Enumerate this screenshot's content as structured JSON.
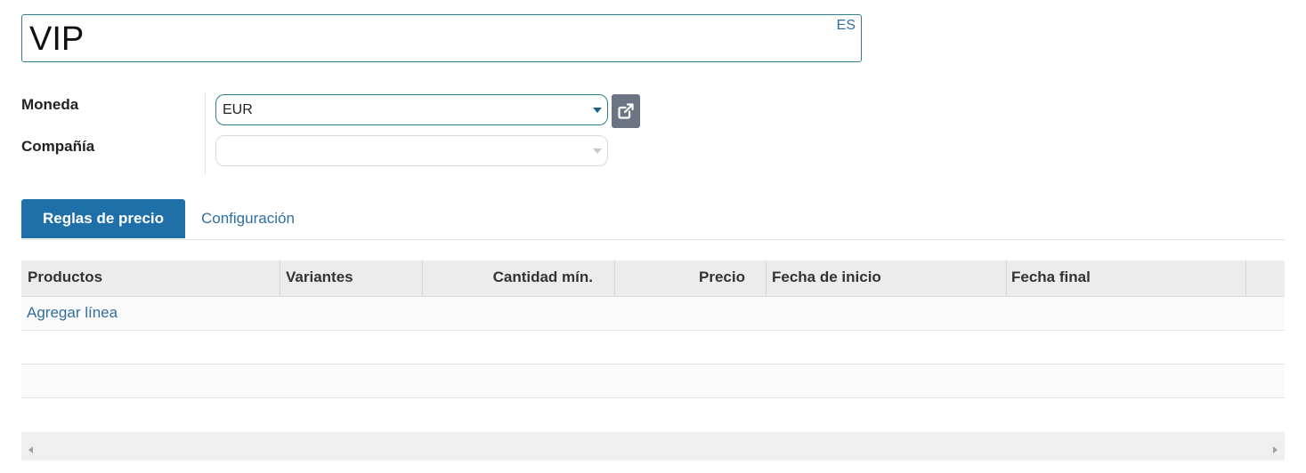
{
  "record": {
    "name": "VIP",
    "lang_button": "ES"
  },
  "form": {
    "currency_label": "Moneda",
    "currency_value": "EUR",
    "company_label": "Compañía",
    "company_value": ""
  },
  "tabs": [
    {
      "label": "Reglas de precio",
      "active": true
    },
    {
      "label": "Configuración",
      "active": false
    }
  ],
  "table": {
    "columns": [
      "Productos",
      "Variantes",
      "Cantidad mín.",
      "Precio",
      "Fecha de inicio",
      "Fecha final"
    ],
    "add_line_label": "Agregar línea"
  },
  "icons": {
    "external_link": "external-link-icon",
    "dropdown": "caret-down-icon"
  },
  "colors": {
    "accent": "#1f6fa8",
    "link": "#2f6f9f",
    "field_border": "#2f7f8f",
    "ext_button": "#6c7484"
  }
}
